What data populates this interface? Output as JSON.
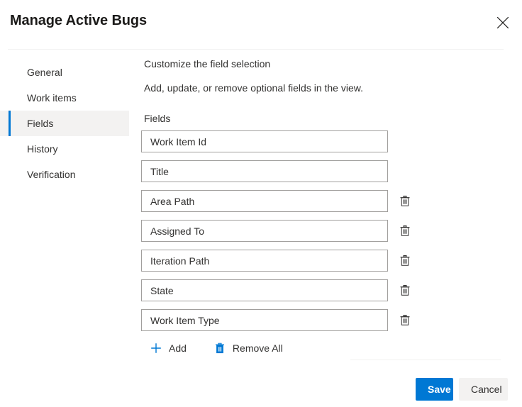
{
  "dialog": {
    "title": "Manage Active Bugs",
    "close_icon": "close-icon"
  },
  "sidebar": {
    "items": [
      {
        "label": "General",
        "selected": false
      },
      {
        "label": "Work items",
        "selected": false
      },
      {
        "label": "Fields",
        "selected": true
      },
      {
        "label": "History",
        "selected": false
      },
      {
        "label": "Verification",
        "selected": false
      }
    ]
  },
  "main": {
    "heading": "Customize the field selection",
    "subheading": "Add, update, or remove optional fields in the view.",
    "fields_label": "Fields",
    "fields": [
      {
        "value": "Work Item Id",
        "placeholder": "Work Item Id",
        "deletable": false
      },
      {
        "value": "Title",
        "placeholder": "Title",
        "deletable": false
      },
      {
        "value": "Area Path",
        "placeholder": "Area Path",
        "deletable": true
      },
      {
        "value": "Assigned To",
        "placeholder": "Assigned To",
        "deletable": true
      },
      {
        "value": "Iteration Path",
        "placeholder": "Iteration Path",
        "deletable": true
      },
      {
        "value": "State",
        "placeholder": "State",
        "deletable": true
      },
      {
        "value": "Work Item Type",
        "placeholder": "Work Item Type",
        "deletable": true
      }
    ],
    "actions": {
      "add_label": "Add",
      "add_icon": "plus-icon",
      "remove_all_label": "Remove All",
      "remove_all_icon": "trash-icon",
      "row_delete_icon": "trash-icon"
    }
  },
  "footer": {
    "save_label": "Save",
    "cancel_label": "Cancel"
  },
  "colors": {
    "accent": "#0078d4",
    "selected_bg": "#f3f2f1",
    "border": "#a19f9d",
    "divider": "#f1f1f1",
    "text": "#323130",
    "icon_gray": "#323130"
  }
}
